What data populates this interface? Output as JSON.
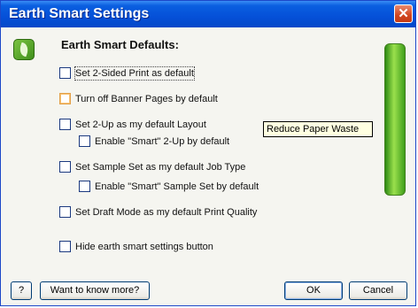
{
  "window": {
    "title": "Earth Smart Settings",
    "close_glyph": "✕"
  },
  "section_title": "Earth Smart Defaults:",
  "options": [
    {
      "label": "Set 2-Sided Print as default",
      "checked": false
    },
    {
      "label": "Turn off Banner Pages by default",
      "checked": false
    },
    {
      "label": "Set 2-Up as my default Layout",
      "checked": false
    },
    {
      "label": "Enable \"Smart\" 2-Up by default",
      "checked": false
    },
    {
      "label": "Set Sample Set as my default Job Type",
      "checked": false
    },
    {
      "label": "Enable \"Smart\" Sample Set by default",
      "checked": false
    },
    {
      "label": "Set Draft Mode as my default Print Quality",
      "checked": false
    },
    {
      "label": "Hide earth smart settings button",
      "checked": false
    }
  ],
  "tooltip": "Reduce Paper Waste",
  "icons": {
    "app": "leaf-icon",
    "gauge": "earth-smart-gauge"
  },
  "buttons": {
    "help": "?",
    "more": "Want to know more?",
    "ok": "OK",
    "cancel": "Cancel"
  },
  "colors": {
    "titlebar": "#0550d8",
    "close": "#d1451e",
    "gauge": "#7ccd3a"
  }
}
